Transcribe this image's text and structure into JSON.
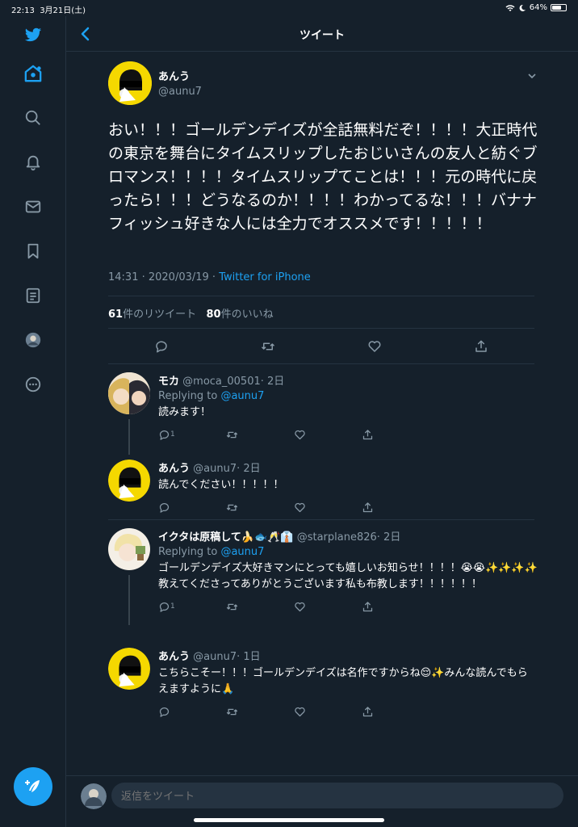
{
  "status_bar": {
    "time": "22:13",
    "date": "3月21日(土)",
    "battery": "64%",
    "battery_level": 0.64
  },
  "header": {
    "title": "ツイート"
  },
  "main_tweet": {
    "name": "あんう",
    "handle": "@aunu7",
    "text": "おい！！！ゴールデンデイズが全話無料だぞ！！！！大正時代の東京を舞台にタイムスリップしたおじいさんの友人と紡ぐブロマンス！！！！タイムスリップてことは！！！元の時代に戻ったら！！！どうなるのか！！！！わかってるな！！！バナナフィッシュ好きな人には全力でオススメです！！！！！",
    "timestamp": "14:31 · 2020/03/19 · ",
    "source": "Twitter for iPhone",
    "retweet_count": "61",
    "retweet_label": "件のリツイート",
    "like_count": "80",
    "like_label": "件のいいね"
  },
  "replies": [
    {
      "name": "モカ",
      "handle": "@moca_00501",
      "time": "· 2日",
      "replying_prefix": "Replying to ",
      "replying_to": "@aunu7",
      "text": "読みます！",
      "reply_count": "1"
    },
    {
      "name": "あんう",
      "handle": "@aunu7",
      "time": "· 2日",
      "text": "読んでください！！！！！",
      "reply_count": ""
    },
    {
      "name": "イクタは原稿して🍌🐟🥂👔",
      "handle": "@starplane826",
      "time": "· 2日",
      "replying_prefix": "Replying to ",
      "replying_to": "@aunu7",
      "text": "ゴールデンデイズ大好きマンにとっても嬉しいお知らせ！！！！😭😭✨✨✨✨教えてくださってありがとうございます私も布教します！！！！！！",
      "reply_count": "1"
    },
    {
      "name": "あんう",
      "handle": "@aunu7",
      "time": "· 1日",
      "text": "こちらこそー！！！ゴールデンデイズは名作ですからね😌✨みんな読んでもらえますように🙏",
      "reply_count": ""
    }
  ],
  "compose": {
    "placeholder": "返信をツイート"
  },
  "colors": {
    "background": "#15202b",
    "accent": "#1da1f2",
    "muted": "#8899a6",
    "border": "#253341"
  },
  "icons": {
    "sidebar": [
      "twitter-logo-icon",
      "home-icon",
      "search-icon",
      "bell-icon",
      "mail-icon",
      "bookmark-icon",
      "list-icon",
      "profile-icon",
      "more-icon"
    ],
    "actions": [
      "reply-icon",
      "retweet-icon",
      "like-icon",
      "share-icon"
    ]
  }
}
